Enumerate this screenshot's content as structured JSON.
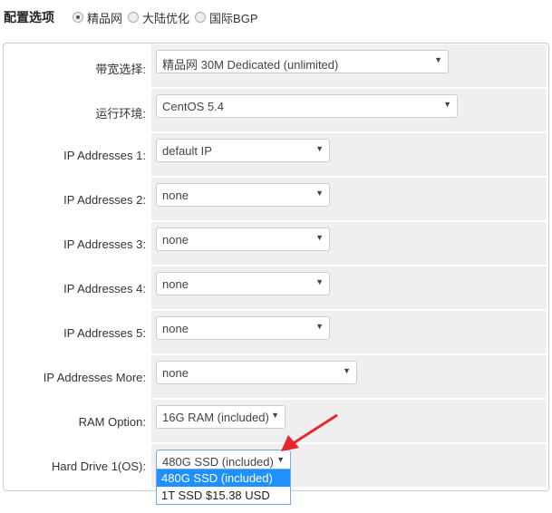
{
  "header": {
    "title": "配置选项",
    "options": [
      {
        "label": "精品网",
        "checked": true
      },
      {
        "label": "大陆优化",
        "checked": false
      },
      {
        "label": "国际BGP",
        "checked": false
      }
    ]
  },
  "rows": [
    {
      "label": "带宽选择:",
      "value": "精品网 30M Dedicated (unlimited)"
    },
    {
      "label": "运行环境:",
      "value": "CentOS 5.4"
    },
    {
      "label": "IP Addresses 1:",
      "value": "default IP"
    },
    {
      "label": "IP Addresses 2:",
      "value": "none"
    },
    {
      "label": "IP Addresses 3:",
      "value": "none"
    },
    {
      "label": "IP Addresses 4:",
      "value": "none"
    },
    {
      "label": "IP Addresses 5:",
      "value": "none"
    },
    {
      "label": "IP Addresses More:",
      "value": "none"
    },
    {
      "label": "RAM Option:",
      "value": "16G RAM (included)"
    },
    {
      "label": "Hard Drive 1(OS):",
      "value": "480G SSD (included)"
    }
  ],
  "dropdown": {
    "options": [
      "480G SSD (included)",
      "1T SSD $15.38 USD"
    ],
    "highlighted": 0
  },
  "colors": {
    "annotation_arrow": "#e8262b",
    "highlight": "#1e90ff"
  }
}
